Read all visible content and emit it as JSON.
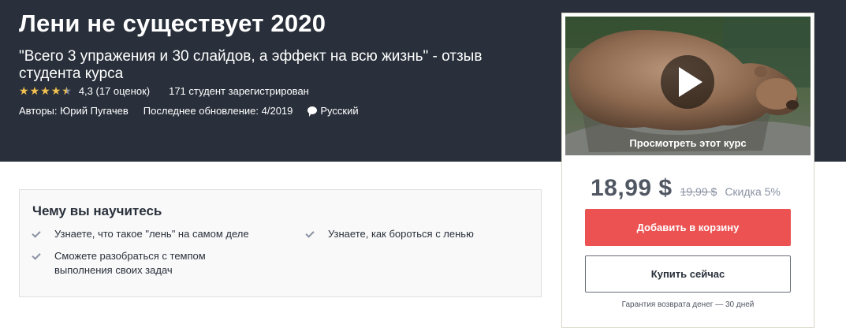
{
  "course": {
    "title": "Лени не существует 2020",
    "subtitle": "\"Всего 3 упражения и 30 слайдов, а эффект на всю жизнь\" - отзыв студента курса",
    "rating": "4,3 (17 оценок)",
    "stars": 4.3,
    "students": "171 студент зарегистрирован",
    "authors": "Авторы: Юрий Пугачев",
    "updated": "Последнее обновление: 4/2019",
    "language": "Русский"
  },
  "preview": {
    "caption": "Просмотреть этот курс"
  },
  "purchase": {
    "price": "18,99 $",
    "old_price": "19,99 $",
    "discount": "Скидка 5%",
    "add_to_cart": "Добавить в корзину",
    "buy_now": "Купить сейчас",
    "guarantee": "Гарантия возврата денег — 30 дней"
  },
  "learn": {
    "title": "Чему вы научитесь",
    "items": [
      "Узнаете, что такое \"лень\" на самом деле",
      "Узнаете, как бороться с ленью",
      "Сможете разобраться с темпом выполнения своих задач"
    ]
  },
  "colors": {
    "hero_bg": "#29303b",
    "star": "#f4c150",
    "cart_button": "#ec5252"
  },
  "icons": [
    "star-icon",
    "speech-bubble-icon",
    "play-icon",
    "check-icon"
  ]
}
